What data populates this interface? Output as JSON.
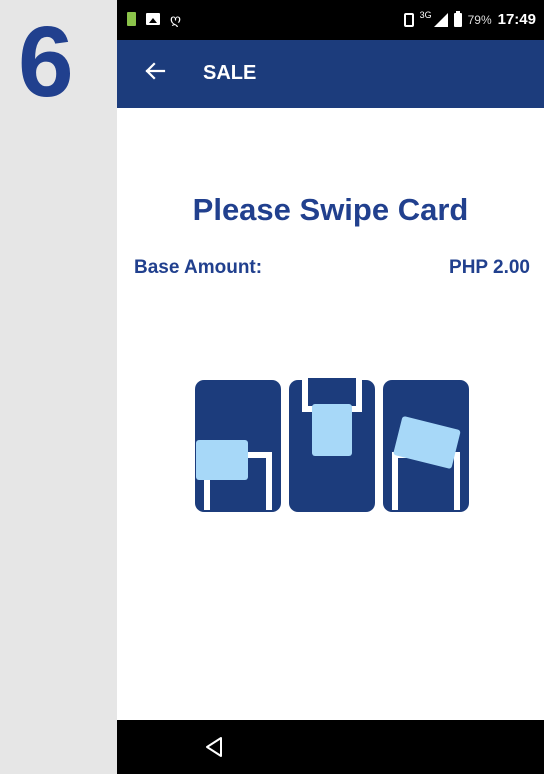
{
  "step": {
    "number": "6"
  },
  "status_bar": {
    "battery_percent": "79%",
    "time": "17:49",
    "network": "3G",
    "icons": [
      "notification-green-icon",
      "image-icon",
      "bird-icon",
      "vibrate-icon",
      "signal-icon",
      "battery-icon"
    ]
  },
  "app_bar": {
    "back_icon": "back-arrow-icon",
    "title": "SALE",
    "background": "#1c3c7c"
  },
  "main": {
    "prompt": "Please Swipe Card",
    "base_amount_label": "Base Amount:",
    "base_amount_value": "PHP 2.00",
    "illustration": [
      "card-swipe-icon",
      "card-insert-icon",
      "card-tap-icon"
    ]
  },
  "nav_bar": {
    "back_icon": "nav-back-icon"
  },
  "colors": {
    "brand": "#21408e",
    "card_light": "#a7d8f8",
    "terminal": "#1c3c7c"
  }
}
